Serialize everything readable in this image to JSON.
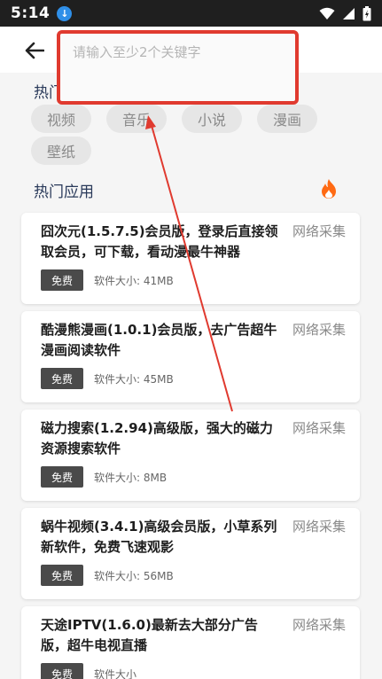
{
  "status": {
    "time": "5:14",
    "download_glyph": "↓"
  },
  "search": {
    "placeholder": "请输入至少2个关键字",
    "value": ""
  },
  "hot_recommend": {
    "title": "热门推荐",
    "tags": [
      "视频",
      "音乐",
      "小说",
      "漫画",
      "壁纸"
    ]
  },
  "hot_apps": {
    "title": "热门应用",
    "items": [
      {
        "title": "囧次元(1.5.7.5)会员版，登录后直接领取会员，可下载，看动漫最牛神器",
        "source": "网络采集",
        "badge": "免费",
        "size": "软件大小: 41MB"
      },
      {
        "title": "酷漫熊漫画(1.0.1)会员版，去广告超牛漫画阅读软件",
        "source": "网络采集",
        "badge": "免费",
        "size": "软件大小: 45MB"
      },
      {
        "title": "磁力搜索(1.2.94)高级版，强大的磁力资源搜索软件",
        "source": "网络采集",
        "badge": "免费",
        "size": "软件大小: 8MB"
      },
      {
        "title": "蜗牛视频(3.4.1)高级会员版，小草系列新软件，免费飞速观影",
        "source": "网络采集",
        "badge": "免费",
        "size": "软件大小: 56MB"
      },
      {
        "title": "天途IPTV(1.6.0)最新去大部分广告版，超牛电视直播",
        "source": "网络采集",
        "badge": "免费",
        "size": "软件大小"
      }
    ]
  },
  "colors": {
    "highlight": "#e03a2f",
    "fire": "#ff6a13",
    "badge": "#4a4a4a"
  },
  "icons": [
    "download-icon",
    "wifi-icon",
    "signal-icon",
    "battery-icon",
    "back-arrow-icon",
    "fire-icon"
  ]
}
